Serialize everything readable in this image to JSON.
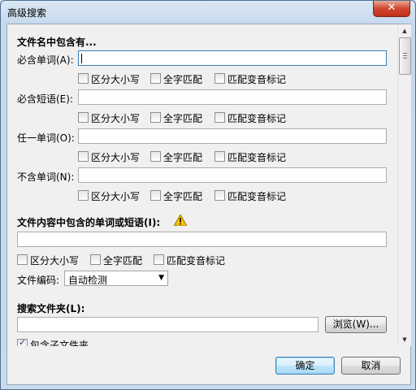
{
  "window": {
    "title": "高级搜索",
    "close_label": "✕"
  },
  "filename_section": {
    "heading": "文件名中包含有...",
    "rows": [
      {
        "label": "必含单词(A):",
        "value": ""
      },
      {
        "label": "必含短语(E):",
        "value": ""
      },
      {
        "label": "任一单词(O):",
        "value": ""
      },
      {
        "label": "不含单词(N):",
        "value": ""
      }
    ],
    "options": {
      "case": "区分大小写",
      "whole": "全字匹配",
      "diacritics": "匹配变音标记"
    }
  },
  "content_section": {
    "heading": "文件内容中包含的单词或短语(I):",
    "value": "",
    "options": {
      "case": "区分大小写",
      "whole": "全字匹配",
      "diacritics": "匹配变音标记"
    },
    "encoding_label": "文件编码:",
    "encoding_value": "自动检测"
  },
  "folder_section": {
    "heading": "搜索文件夹(L):",
    "value": "",
    "browse_label": "浏览(W)...",
    "subfolders_label": "包含子文件夹",
    "subfolders_checked": true
  },
  "footer": {
    "ok_label": "确定",
    "cancel_label": "取消"
  }
}
